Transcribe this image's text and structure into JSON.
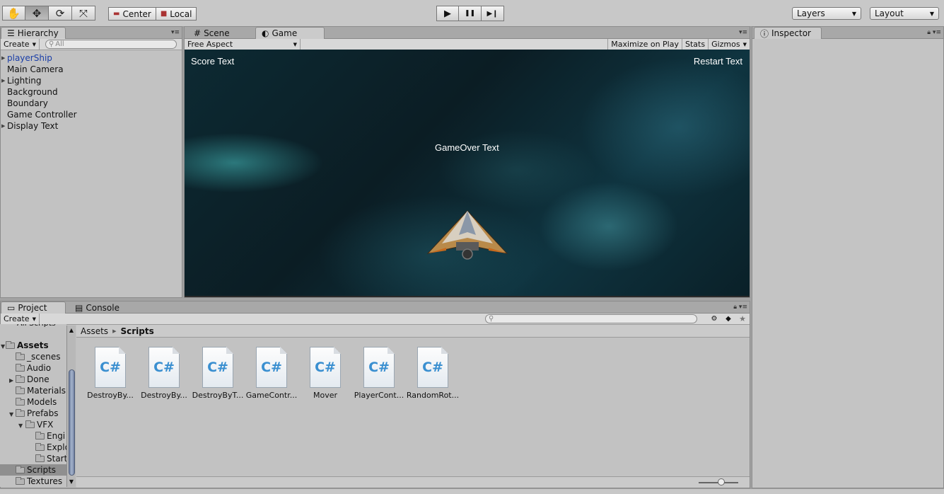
{
  "toolbar": {
    "transform_tools": [
      {
        "name": "hand-tool",
        "glyph": "✋"
      },
      {
        "name": "move-tool",
        "glyph": "✥"
      },
      {
        "name": "rotate-tool",
        "glyph": "⟳"
      },
      {
        "name": "scale-tool",
        "glyph": "⤧"
      }
    ],
    "pivot_label": "Center",
    "space_label": "Local",
    "play_glyph": "▶",
    "pause_glyph": "❚❚",
    "step_glyph": "▶❙",
    "layers_label": "Layers",
    "layout_label": "Layout"
  },
  "hierarchy": {
    "tab_label": "Hierarchy",
    "create_label": "Create",
    "search_placeholder": "All",
    "items": [
      {
        "label": "playerShip",
        "foldout": true,
        "selected": true
      },
      {
        "label": "Main Camera",
        "foldout": false
      },
      {
        "label": "Lighting",
        "foldout": true
      },
      {
        "label": "Background",
        "foldout": false
      },
      {
        "label": "Boundary",
        "foldout": false
      },
      {
        "label": "Game Controller",
        "foldout": false
      },
      {
        "label": "Display Text",
        "foldout": true
      }
    ]
  },
  "scene_tabs": {
    "scene_label": "Scene",
    "game_label": "Game",
    "aspect_label": "Free Aspect",
    "maximize_label": "Maximize on Play",
    "stats_label": "Stats",
    "gizmos_label": "Gizmos"
  },
  "game": {
    "score_text": "Score Text",
    "restart_text": "Restart Text",
    "gameover_text": "GameOver Text"
  },
  "inspector": {
    "tab_label": "Inspector"
  },
  "project": {
    "project_tab": "Project",
    "console_tab": "Console",
    "create_label": "Create",
    "breadcrumb_root": "Assets",
    "breadcrumb_current": "Scripts",
    "tree": {
      "assets": "Assets",
      "scenes": "_scenes",
      "audio": "Audio",
      "done": "Done",
      "materials": "Materials",
      "models": "Models",
      "prefabs": "Prefabs",
      "vfx": "VFX",
      "engines": "Engi",
      "explosions": "Explo",
      "starfield": "Start",
      "scripts": "Scripts",
      "textures": "Textures"
    },
    "scripts": [
      {
        "label": "DestroyBy...",
        "icon": "C#"
      },
      {
        "label": "DestroyBy...",
        "icon": "C#"
      },
      {
        "label": "DestroyByT...",
        "icon": "C#"
      },
      {
        "label": "GameContr...",
        "icon": "C#"
      },
      {
        "label": "Mover",
        "icon": "C#"
      },
      {
        "label": "PlayerCont...",
        "icon": "C#"
      },
      {
        "label": "RandomRot...",
        "icon": "C#"
      }
    ]
  }
}
